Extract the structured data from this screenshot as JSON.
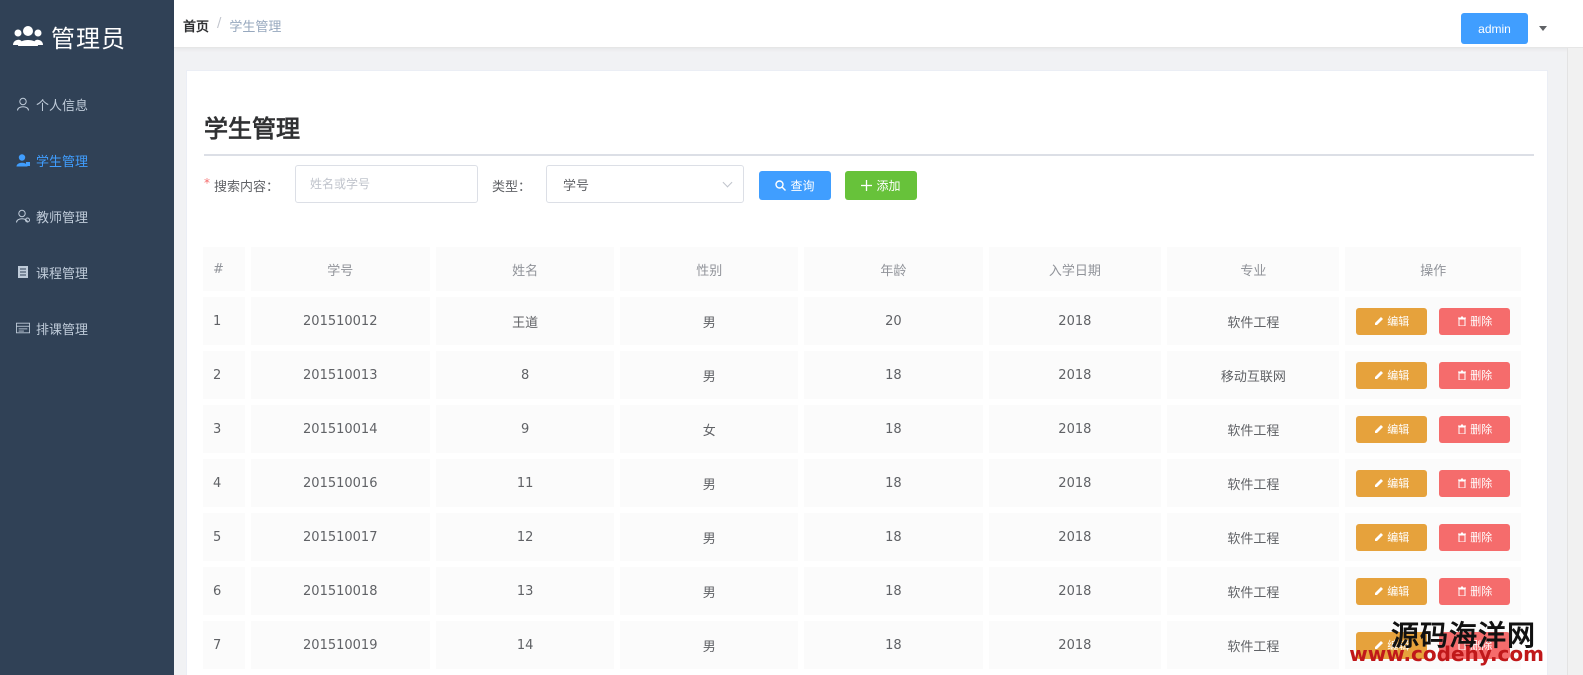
{
  "sidebar": {
    "title": "管理员",
    "items": [
      {
        "label": "个人信息",
        "icon": "user-icon",
        "active": false
      },
      {
        "label": "学生管理",
        "icon": "student-icon",
        "active": true
      },
      {
        "label": "教师管理",
        "icon": "teacher-icon",
        "active": false
      },
      {
        "label": "课程管理",
        "icon": "book-icon",
        "active": false
      },
      {
        "label": "排课管理",
        "icon": "schedule-icon",
        "active": false
      }
    ]
  },
  "header": {
    "breadcrumb": [
      "首页",
      "/",
      "学生管理"
    ],
    "user_button": "admin"
  },
  "main": {
    "title": "学生管理",
    "search": {
      "label": "搜索内容：",
      "placeholder": "姓名或学号",
      "type_label": "类型：",
      "type_value": "学号",
      "query_button": "查询",
      "add_button": "添加"
    },
    "table": {
      "columns": [
        "#",
        "学号",
        "姓名",
        "性别",
        "年龄",
        "入学日期",
        "专业",
        "操作"
      ],
      "rows": [
        [
          "1",
          "201510012",
          "王道",
          "男",
          "20",
          "2018",
          "软件工程"
        ],
        [
          "2",
          "201510013",
          "8",
          "男",
          "18",
          "2018",
          "移动互联网"
        ],
        [
          "3",
          "201510014",
          "9",
          "女",
          "18",
          "2018",
          "软件工程"
        ],
        [
          "4",
          "201510016",
          "11",
          "男",
          "18",
          "2018",
          "软件工程"
        ],
        [
          "5",
          "201510017",
          "12",
          "男",
          "18",
          "2018",
          "软件工程"
        ],
        [
          "6",
          "201510018",
          "13",
          "男",
          "18",
          "2018",
          "软件工程"
        ],
        [
          "7",
          "201510019",
          "14",
          "男",
          "18",
          "2018",
          "软件工程"
        ]
      ],
      "edit_label": "编辑",
      "delete_label": "删除"
    }
  },
  "watermark": {
    "line1": "源码海洋网",
    "line2": "www.codehy.com"
  },
  "colors": {
    "sidebar_bg": "#304156",
    "accent": "#409eff",
    "success": "#67c23a",
    "warning": "#e6a23c",
    "danger": "#f56c6c"
  }
}
